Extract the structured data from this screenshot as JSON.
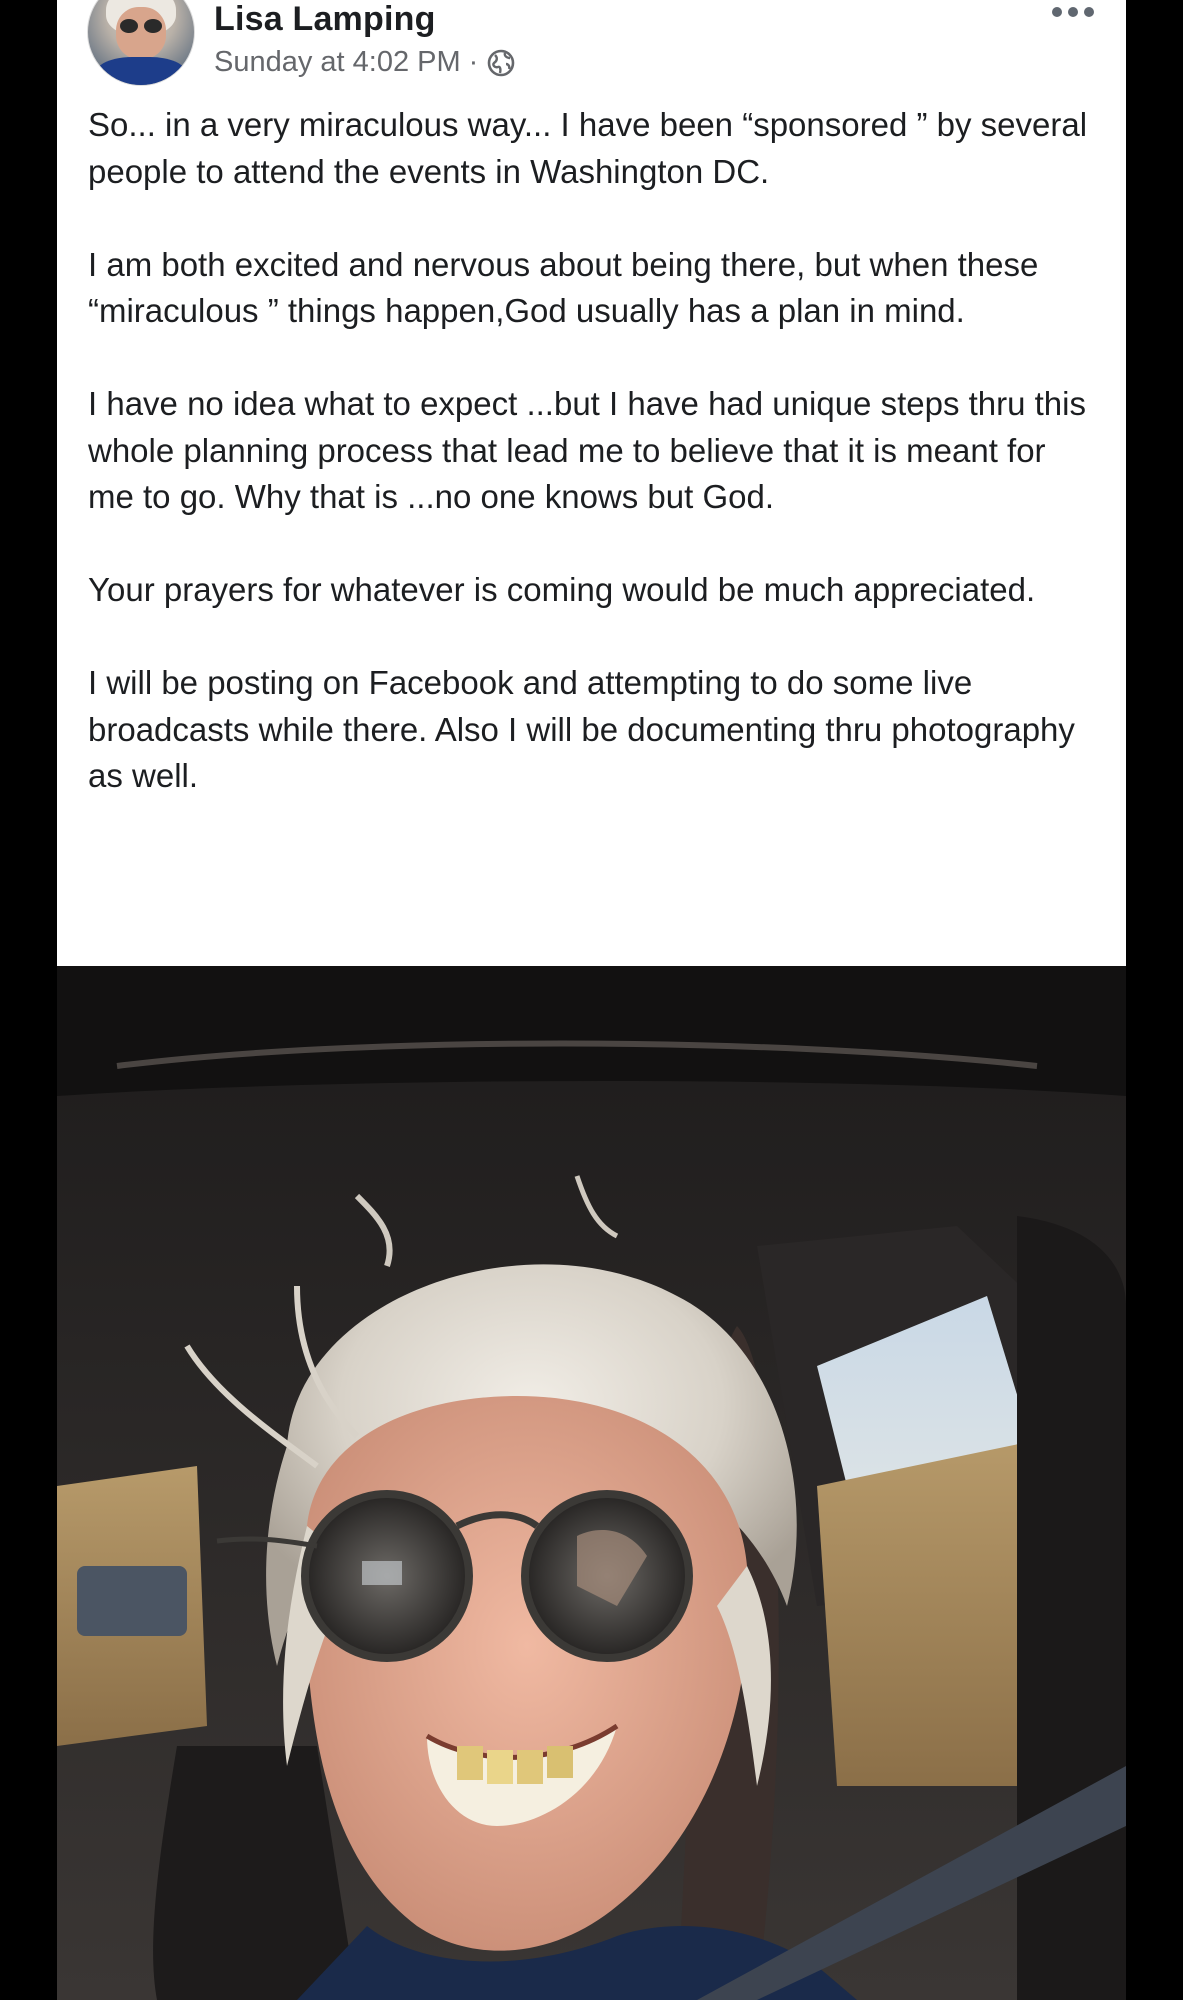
{
  "post": {
    "author": "Lisa Lamping",
    "timestamp": "Sunday at 4:02 PM",
    "separator": "·",
    "privacy_icon": "globe-icon",
    "more_icon": "more-options-icon",
    "paragraphs": [
      "So... in a very miraculous way... I have been “sponsored ” by several people to attend the events in Washington DC.",
      "I am both excited and nervous about being there, but when these “miraculous ” things happen,God usually has a plan in mind.",
      "I have no idea what to expect ...but I have had unique steps thru this whole planning process that lead me to believe that it is meant for me to go.  Why that is ...no one knows but God.",
      "Your prayers for whatever is coming would be much appreciated.",
      "I will be posting on Facebook and attempting to do some live broadcasts while there. Also I will be documenting thru photography as well."
    ]
  },
  "colors": {
    "background": "#000000",
    "card": "#ffffff",
    "text": "#1c1e21",
    "secondary_text": "#65676b"
  }
}
